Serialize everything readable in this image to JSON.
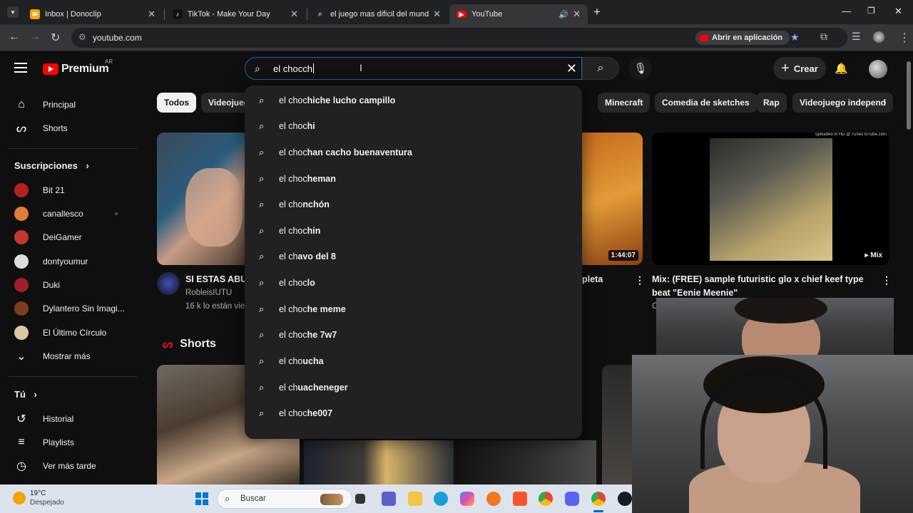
{
  "browser": {
    "tabs": [
      {
        "title": "Inbox | Donoclip",
        "icon": "mail-icon",
        "color": "#f2a900"
      },
      {
        "title": "TikTok - Make Your Day",
        "icon": "tiktok-icon",
        "color": "#000000"
      },
      {
        "title": "el juego mas dificil del mundo",
        "icon": "search-icon",
        "color": "#8ab4f8"
      },
      {
        "title": "YouTube",
        "icon": "youtube-icon",
        "color": "#ff0000"
      }
    ],
    "url": "youtube.com",
    "open_in_app": "Abrir en aplicación"
  },
  "youtube": {
    "logo_word": "Premium",
    "country": "AR",
    "search_query": "el chocch",
    "create_label": "Crear",
    "suggestions": [
      {
        "typed": "el choc",
        "rest": "hiche lucho campillo"
      },
      {
        "typed": "el choc",
        "rest": "hi"
      },
      {
        "typed": "el choc",
        "rest": "han cacho buenaventura"
      },
      {
        "typed": "el choc",
        "rest": "heman"
      },
      {
        "typed": "el cho",
        "rest": "nchón"
      },
      {
        "typed": "el choc",
        "rest": "hin"
      },
      {
        "typed": "el ch",
        "rest": "avo del 8"
      },
      {
        "typed": "el choc",
        "rest": "lo"
      },
      {
        "typed": "el choc",
        "rest": "he meme"
      },
      {
        "typed": "el choc",
        "rest": "he 7w7"
      },
      {
        "typed": "el cho",
        "rest": "ucha"
      },
      {
        "typed": "el ch",
        "rest": "uacheneger"
      },
      {
        "typed": "el choc",
        "rest": "he007"
      }
    ],
    "sidebar": {
      "main": [
        {
          "label": "Principal",
          "icon": "home-icon"
        },
        {
          "label": "Shorts",
          "icon": "shorts-icon"
        }
      ],
      "subscriptions_title": "Suscripciones",
      "subscriptions": [
        {
          "label": "Bit 21",
          "color": "#b22222",
          "new": false
        },
        {
          "label": "canallesco",
          "color": "#e07b39",
          "new": true
        },
        {
          "label": "DeiGamer",
          "color": "#c0392b",
          "new": false
        },
        {
          "label": "dontyoumur",
          "color": "#dddddd",
          "new": false
        },
        {
          "label": "Duki",
          "color": "#a11d2b",
          "new": false
        },
        {
          "label": "Dylantero Sin Imagi...",
          "color": "#7a3e1d",
          "new": false
        },
        {
          "label": "El Último Círculo",
          "color": "#d9c9a3",
          "new": false
        }
      ],
      "show_more": "Mostrar más",
      "you_title": "Tú",
      "you": [
        {
          "label": "Historial",
          "icon": "history-icon"
        },
        {
          "label": "Playlists",
          "icon": "playlist-icon"
        },
        {
          "label": "Ver más tarde",
          "icon": "clock-icon"
        }
      ]
    },
    "chips": [
      "Todos",
      "Videojueg",
      "Minecraft",
      "Comedia de sketches",
      "Rap",
      "Videojuego independ"
    ],
    "videos": [
      {
        "title": "SI ESTAS ABU",
        "channel": "RobleisIUTU",
        "meta": "16 k lo están vie"
      },
      {
        "title": "pleta",
        "duration": "1:44:07"
      },
      {
        "title": "Mix: (FREE) sample futuristic glo x chief keef type beat \"Eenie Meenie\"",
        "watermark": "uploaded in HD @ TunesToTube.com",
        "channel": "C"
      }
    ],
    "shorts_title": "Shorts"
  },
  "taskbar": {
    "temperature": "19°C",
    "condition": "Despejado",
    "search": "Buscar"
  }
}
